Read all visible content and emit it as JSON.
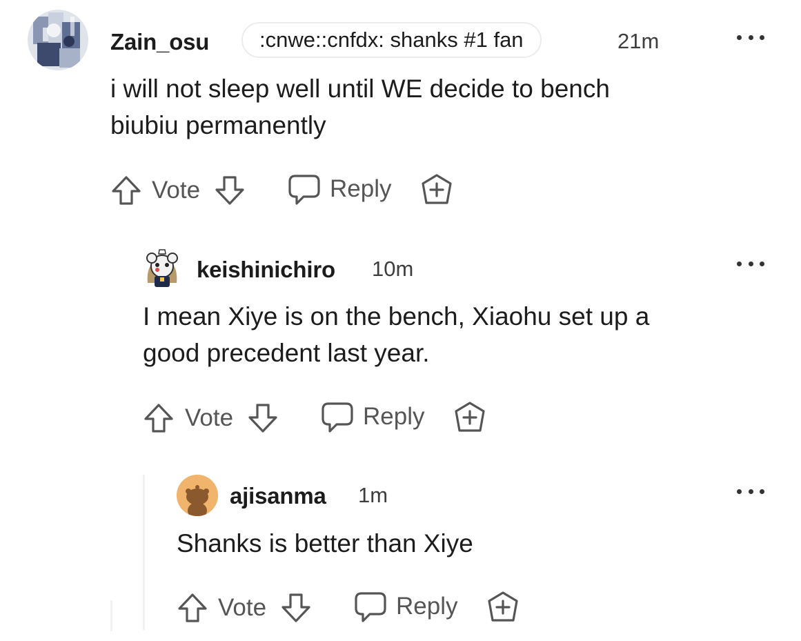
{
  "comments": [
    {
      "username": "Zain_osu",
      "flair": ":cnwe::cnfdx: shanks #1 fan",
      "time": "21m",
      "body_lines": [
        "i will not sleep well until WE decide to bench",
        "biubiu permanently"
      ],
      "vote_label": "Vote",
      "reply_label": "Reply"
    },
    {
      "username": "keishinichiro",
      "time": "10m",
      "body_lines": [
        "I mean Xiye is on the bench, Xiaohu set up a",
        "good precedent last year."
      ],
      "vote_label": "Vote",
      "reply_label": "Reply"
    },
    {
      "username": "ajisanma",
      "time": "1m",
      "body_lines": [
        "Shanks is better than Xiye"
      ],
      "vote_label": "Vote",
      "reply_label": "Reply"
    }
  ],
  "icons": {
    "upvote": "arrow-up-icon",
    "downvote": "arrow-down-icon",
    "reply": "speech-bubble-icon",
    "award": "award-plus-icon",
    "more": "more-dots-icon"
  },
  "colors": {
    "text": "#1c1c1c",
    "muted": "#555555",
    "ajisanma_avatar_bg": "#f0b46c"
  }
}
